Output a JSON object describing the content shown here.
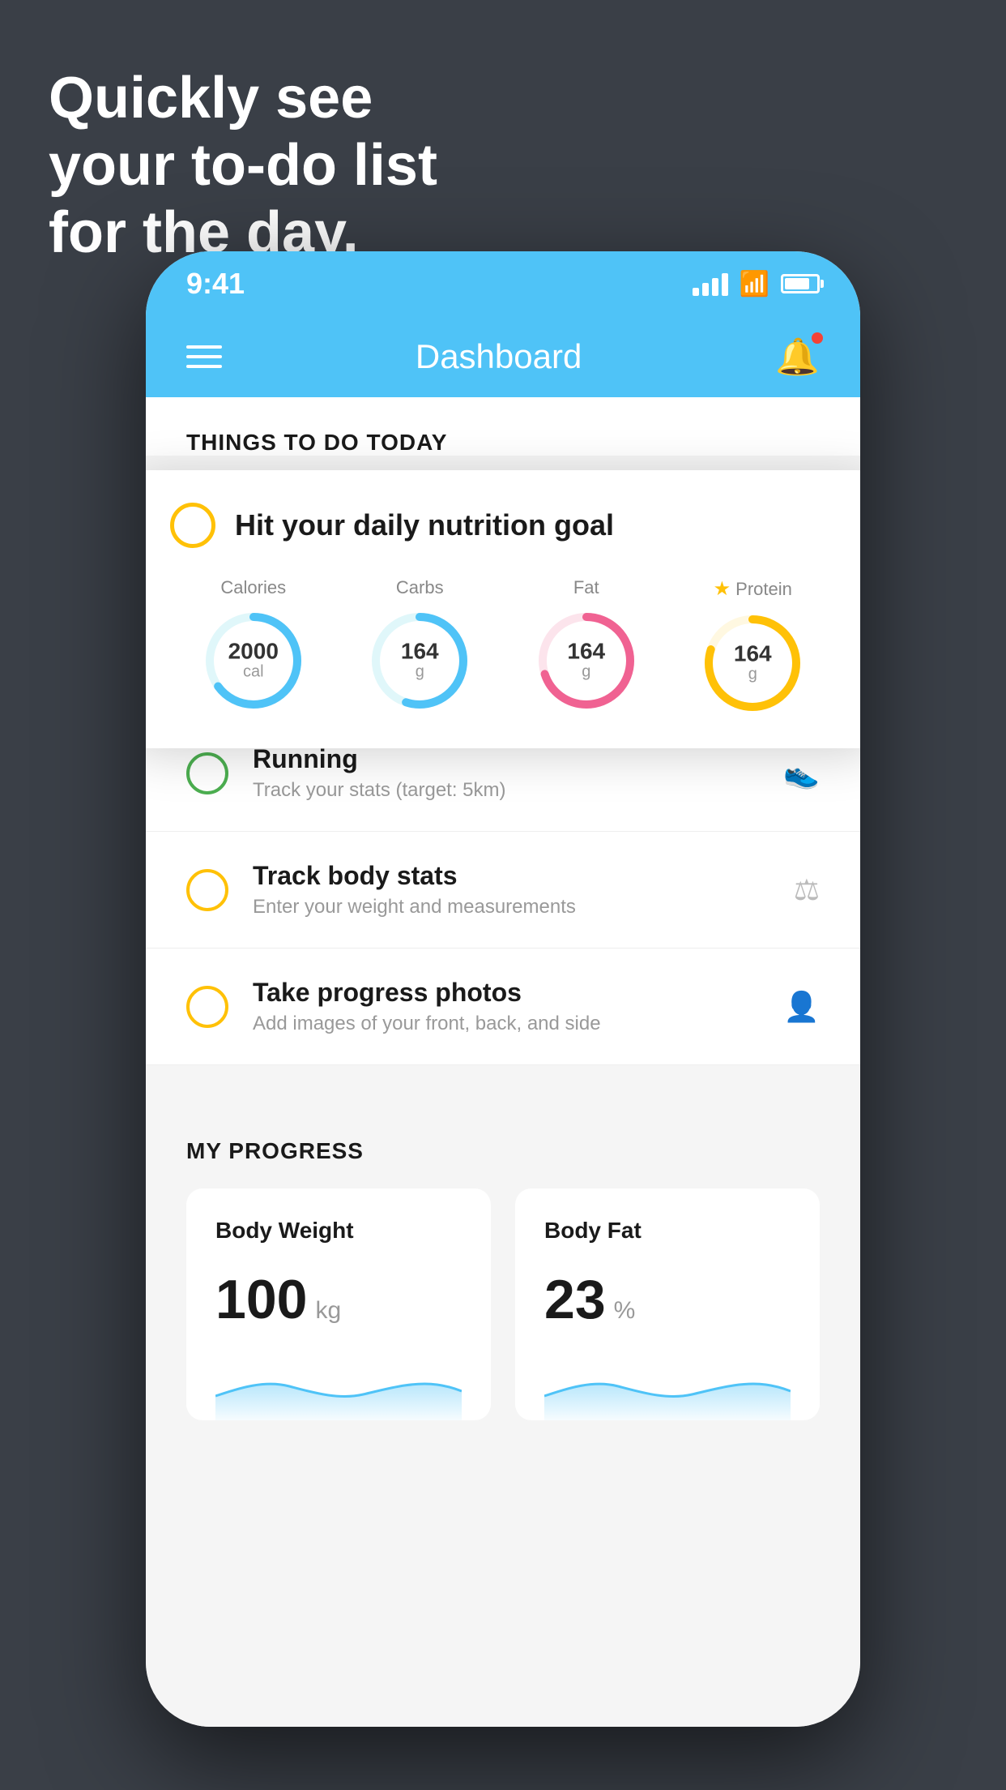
{
  "headline": {
    "line1": "Quickly see",
    "line2": "your to-do list",
    "line3": "for the day."
  },
  "status_bar": {
    "time": "9:41"
  },
  "nav": {
    "title": "Dashboard"
  },
  "section_today": {
    "title": "THINGS TO DO TODAY"
  },
  "nutrition_card": {
    "title": "Hit your daily nutrition goal",
    "items": [
      {
        "label": "Calories",
        "value": "2000",
        "unit": "cal",
        "color": "#4fc3f7",
        "track_color": "#e0f7fa",
        "pct": 65
      },
      {
        "label": "Carbs",
        "value": "164",
        "unit": "g",
        "color": "#4fc3f7",
        "track_color": "#e0f7fa",
        "pct": 55
      },
      {
        "label": "Fat",
        "value": "164",
        "unit": "g",
        "color": "#f06292",
        "track_color": "#fce4ec",
        "pct": 70
      },
      {
        "label": "Protein",
        "value": "164",
        "unit": "g",
        "color": "#ffc107",
        "track_color": "#fff8e1",
        "pct": 80,
        "starred": true
      }
    ]
  },
  "todo_items": [
    {
      "title": "Running",
      "subtitle": "Track your stats (target: 5km)",
      "circle_color": "green",
      "icon": "👟"
    },
    {
      "title": "Track body stats",
      "subtitle": "Enter your weight and measurements",
      "circle_color": "yellow",
      "icon": "⚖"
    },
    {
      "title": "Take progress photos",
      "subtitle": "Add images of your front, back, and side",
      "circle_color": "yellow",
      "icon": "👤"
    }
  ],
  "progress_section": {
    "title": "MY PROGRESS",
    "cards": [
      {
        "title": "Body Weight",
        "value": "100",
        "unit": "kg"
      },
      {
        "title": "Body Fat",
        "value": "23",
        "unit": "%"
      }
    ]
  }
}
